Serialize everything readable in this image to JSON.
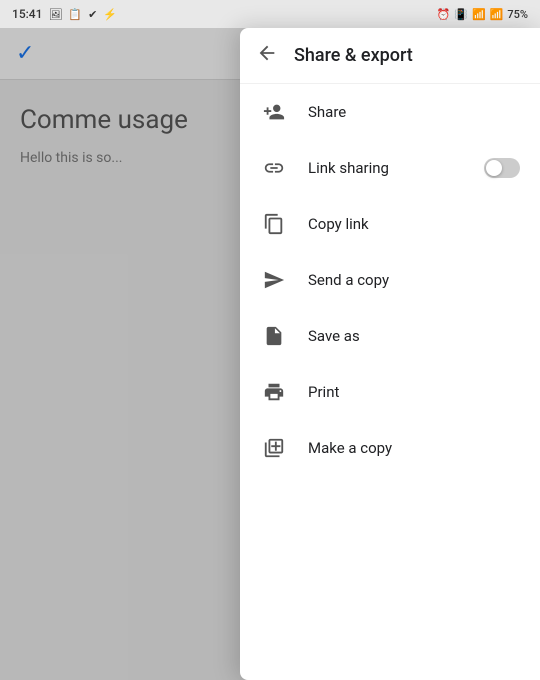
{
  "statusBar": {
    "time": "15:41",
    "battery": "75%"
  },
  "appToolbar": {
    "checkmark": "✓"
  },
  "docContent": {
    "title": "Comme\nusage",
    "body": "Hello this is so..."
  },
  "menu": {
    "title": "Share & export",
    "backLabel": "←",
    "items": [
      {
        "id": "share",
        "label": "Share",
        "icon": "person-add"
      },
      {
        "id": "link-sharing",
        "label": "Link sharing",
        "icon": "link",
        "hasToggle": true
      },
      {
        "id": "copy-link",
        "label": "Copy link",
        "icon": "copy"
      },
      {
        "id": "send-copy",
        "label": "Send a copy",
        "icon": "send"
      },
      {
        "id": "save-as",
        "label": "Save as",
        "icon": "file"
      },
      {
        "id": "print",
        "label": "Print",
        "icon": "print"
      },
      {
        "id": "make-copy",
        "label": "Make a copy",
        "icon": "duplicate"
      }
    ]
  }
}
